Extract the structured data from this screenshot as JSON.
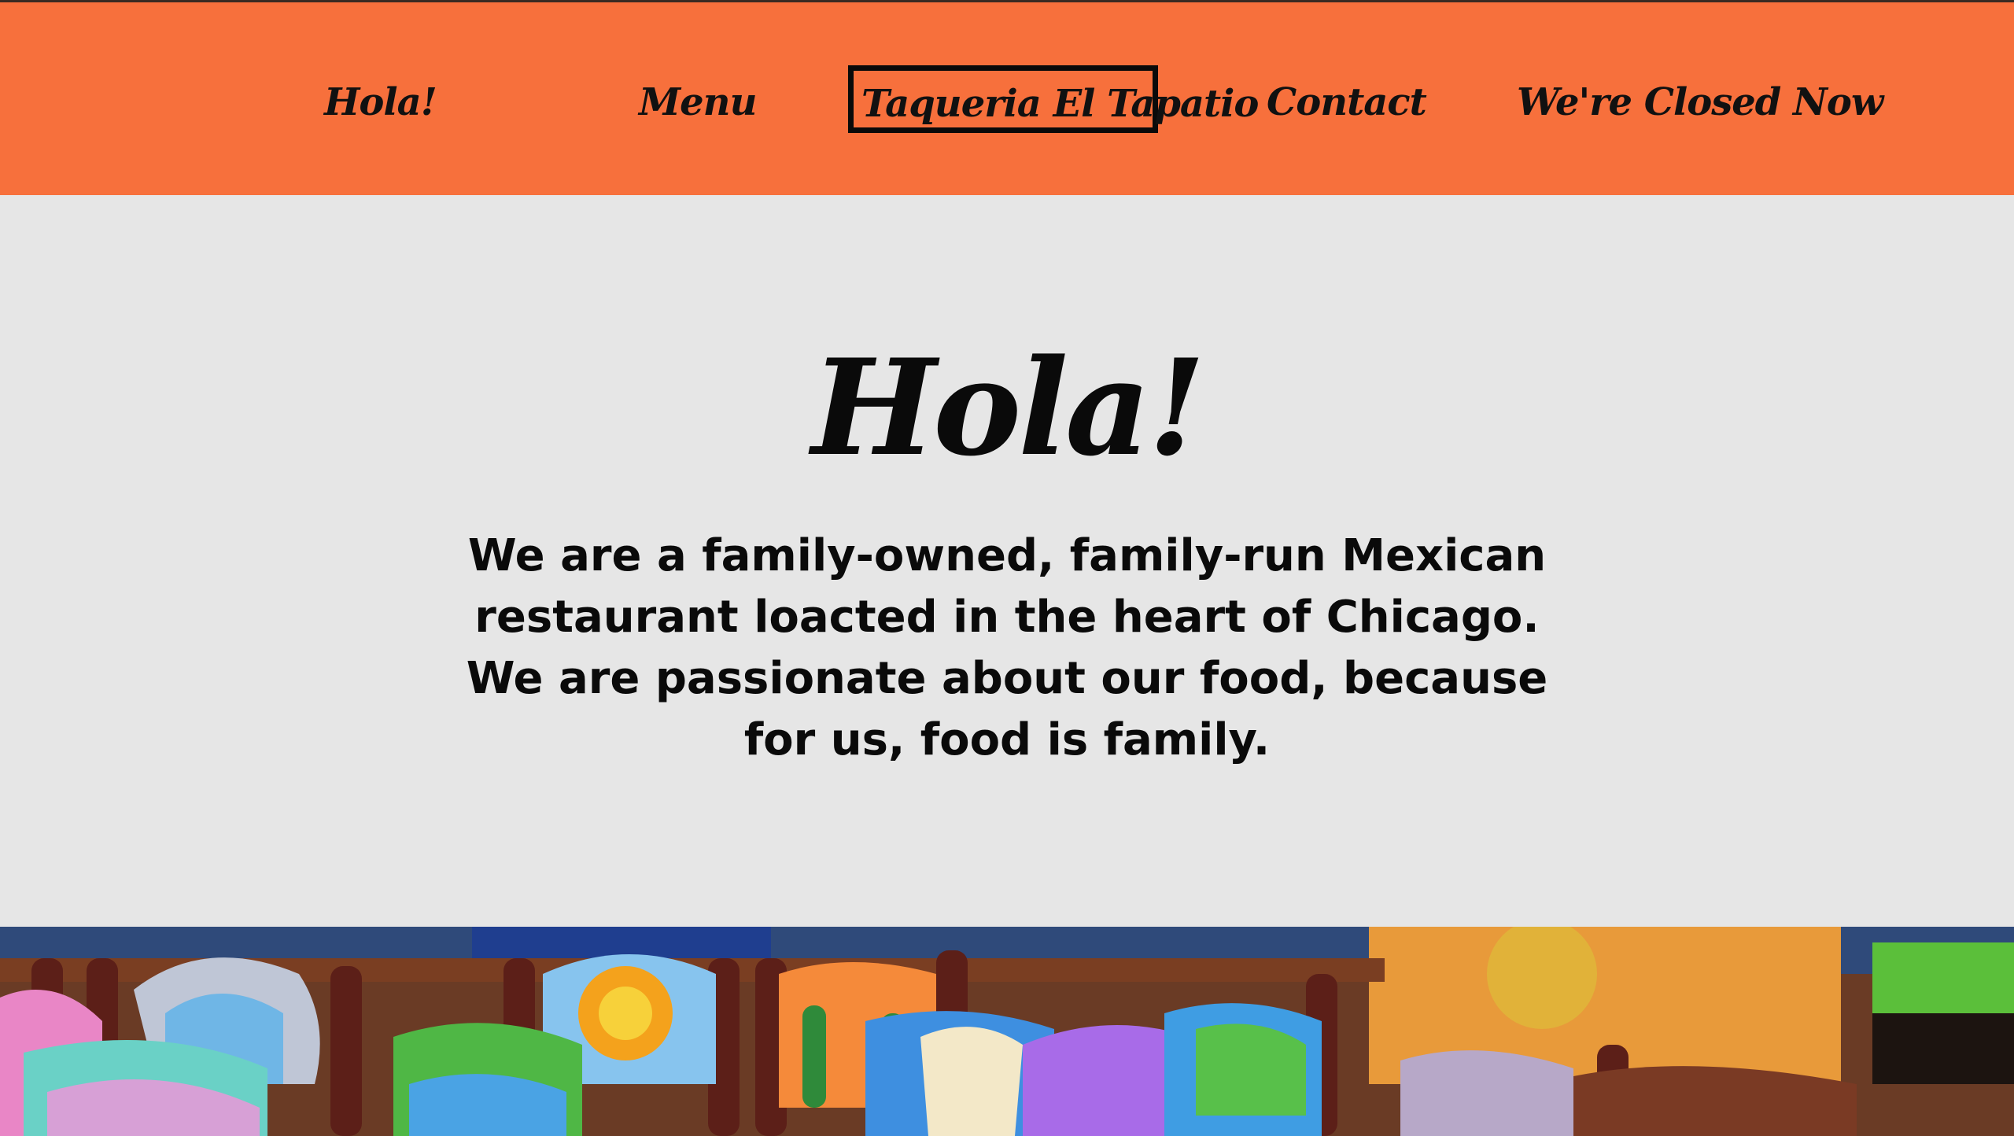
{
  "nav": {
    "items": [
      {
        "label": "Hola!"
      },
      {
        "label": "Menu"
      },
      {
        "label": "Taqueria El Tapatio"
      },
      {
        "label": "Contact"
      },
      {
        "label": "We're Closed Now"
      }
    ]
  },
  "hero": {
    "title": "Hola!",
    "text": "We are a family-owned, family-run Mexican restaurant loacted in the heart of Chicago. We are passionate about our food, because for us, food is family."
  },
  "colors": {
    "nav_background": "#f7703c",
    "page_background": "#e6e6e6",
    "text": "#0a0a0a"
  }
}
